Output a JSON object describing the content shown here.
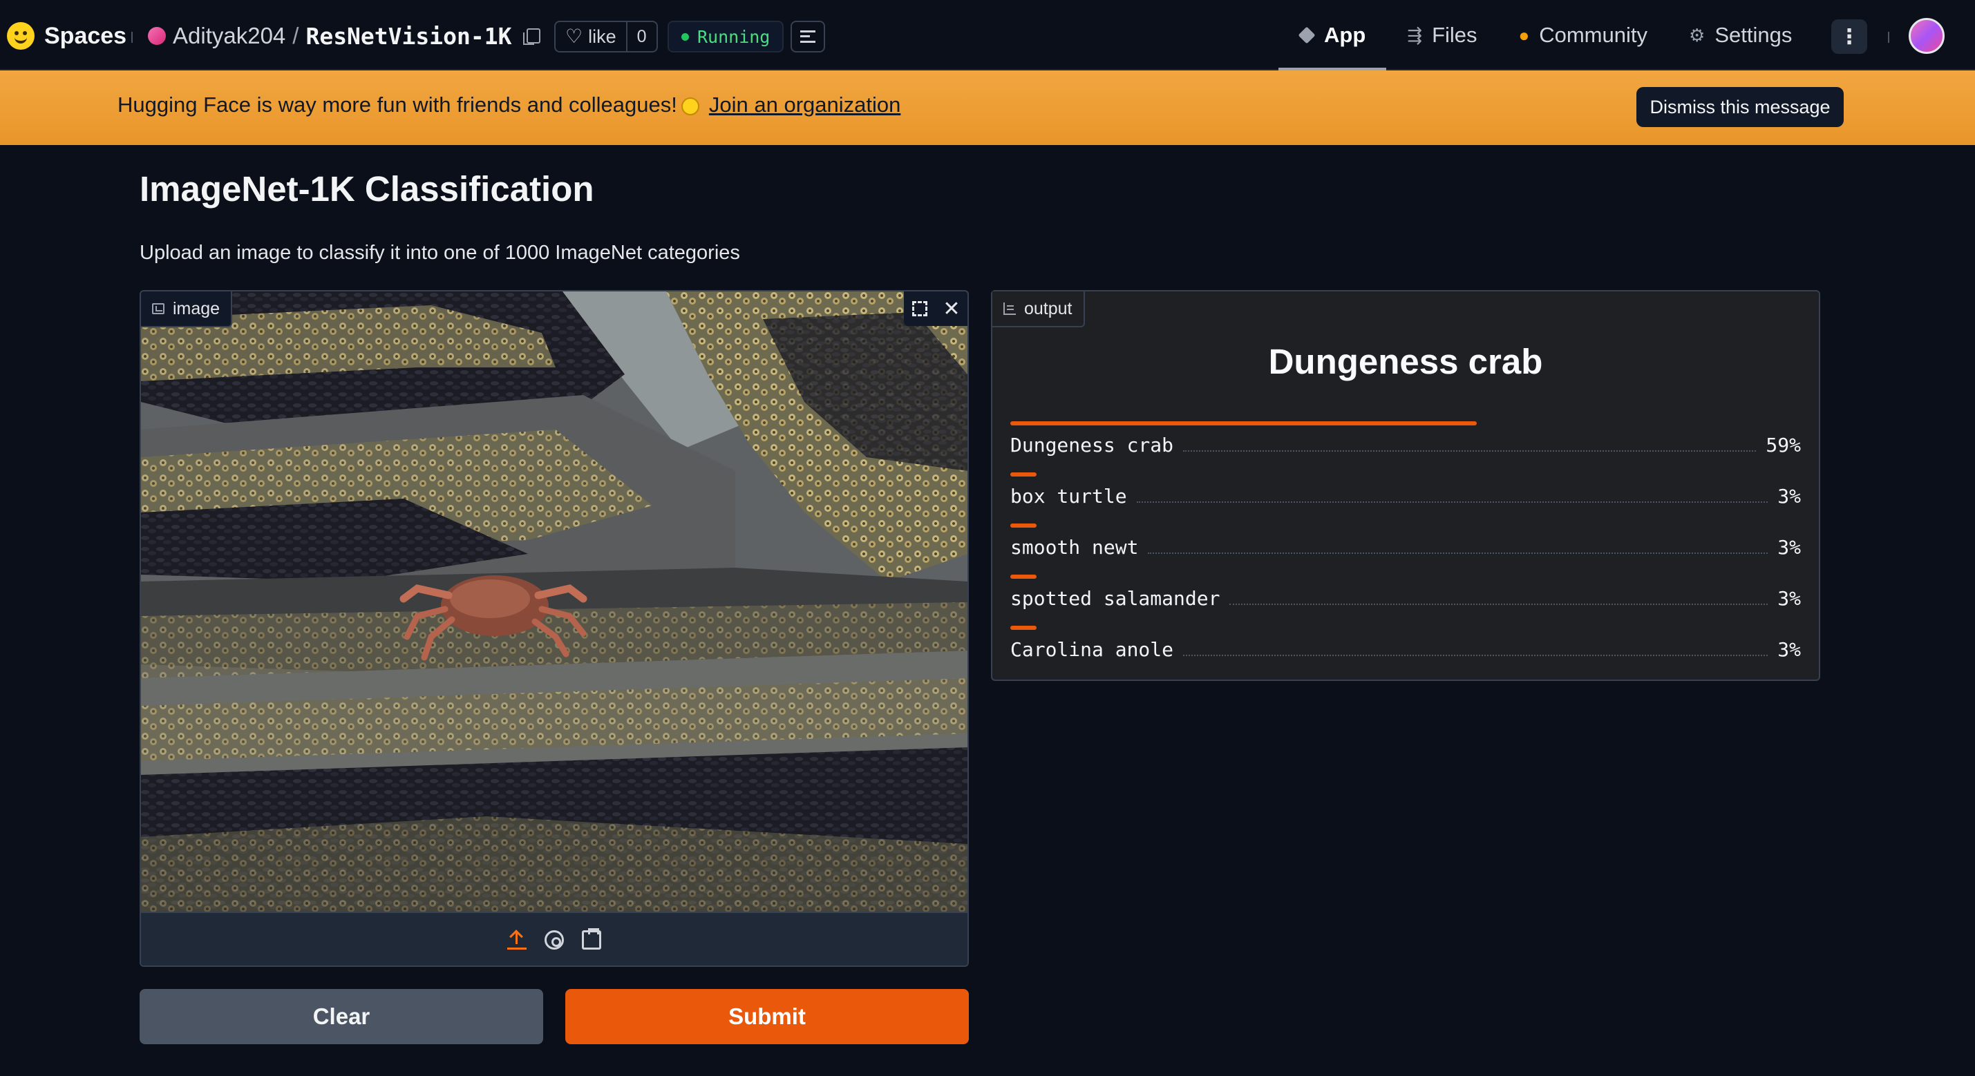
{
  "nav": {
    "brand": "Spaces",
    "owner": "Adityak204",
    "slash": "/",
    "repo": "ResNetVision-1K",
    "like_label": "like",
    "like_count": "0",
    "status": "Running",
    "tabs": [
      {
        "label": "App",
        "icon": "cube-icon"
      },
      {
        "label": "Files",
        "icon": "files-icon"
      },
      {
        "label": "Community",
        "icon": "community-icon"
      },
      {
        "label": "Settings",
        "icon": "gear-icon"
      }
    ],
    "more": "⋮"
  },
  "banner": {
    "text": "Hugging Face is way more fun with friends and colleagues!",
    "link": "Join an organization",
    "dismiss": "Dismiss this message"
  },
  "main": {
    "title": "ImageNet-1K Classification",
    "description": "Upload an image to classify it into one of 1000 ImageNet categories",
    "input_label": "image",
    "output_label": "output",
    "clear": "Clear",
    "submit": "Submit"
  },
  "output": {
    "top_label": "Dungeness crab",
    "confidences": [
      {
        "label": "Dungeness crab",
        "value": 0.59,
        "pct": "59%"
      },
      {
        "label": "box turtle",
        "value": 0.03,
        "pct": "3%"
      },
      {
        "label": "smooth newt",
        "value": 0.03,
        "pct": "3%"
      },
      {
        "label": "spotted salamander",
        "value": 0.03,
        "pct": "3%"
      },
      {
        "label": "Carolina anole",
        "value": 0.03,
        "pct": "3%"
      }
    ]
  },
  "colors": {
    "accent": "#ea580c",
    "running": "#22c55e",
    "banner": "#f2a640"
  }
}
